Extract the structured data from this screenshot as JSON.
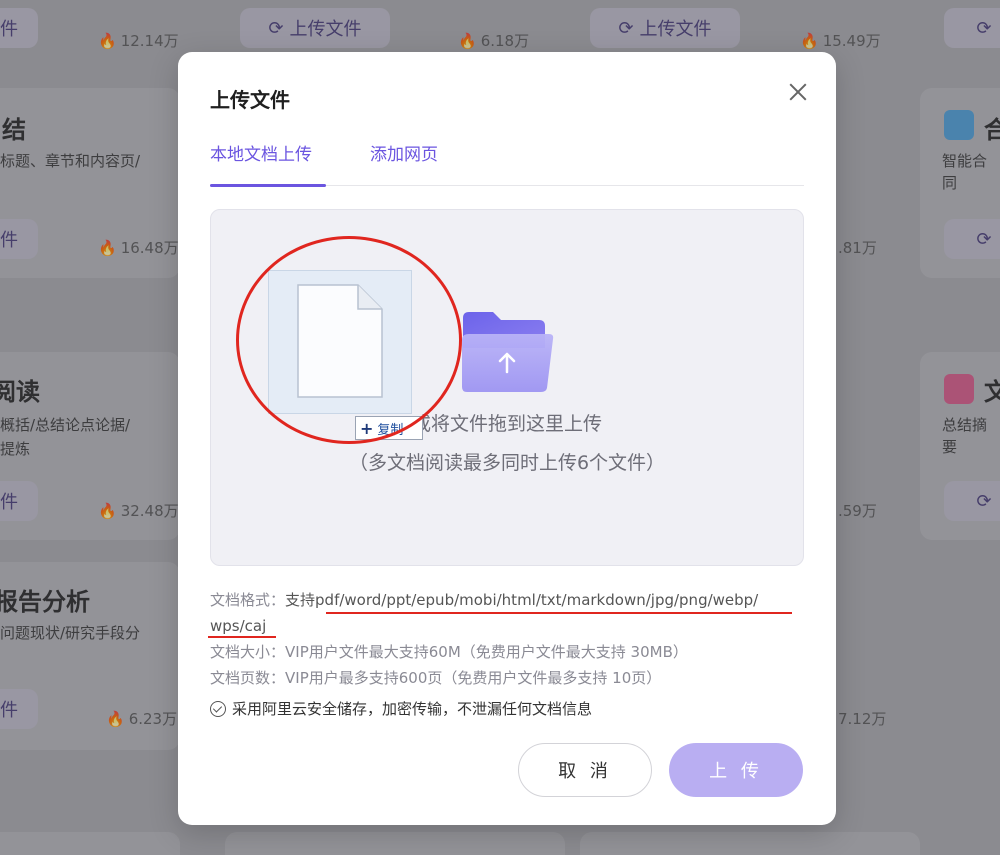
{
  "background": {
    "upload_label": "上传文件",
    "stats": [
      "12.14万",
      "6.18万",
      "15.49万",
      "16.48万",
      ".81万",
      "32.48万",
      ".59万",
      "6.23万",
      "7.12万"
    ],
    "titles": [
      "结",
      "合",
      "阅读",
      "文",
      "报告分析"
    ],
    "descs": [
      "标题、章节和内容页/",
      "智能合同",
      "概括/总结论点论据/",
      "提炼",
      "总结摘要",
      "问题现状/研究手段分"
    ],
    "partial_pill": "件"
  },
  "modal": {
    "title": "上传文件",
    "tabs": [
      {
        "label": "本地文档上传",
        "active": true
      },
      {
        "label": "添加网页",
        "active": false
      }
    ],
    "dropzone": {
      "main_text": "或将文件拖到这里上传",
      "sub_text": "（多文档阅读最多同时上传6个文件）"
    },
    "drag_ghost": {
      "badge": "复制"
    },
    "info": {
      "format_label": "文档格式：",
      "format_prefix": "支持",
      "format_list_1": "pdf/word/ppt/epub/mobi/html/txt/markdown/jpg/png/webp/",
      "format_list_2": "wps/caj",
      "size_label": "文档大小：",
      "size_text": "VIP用户文件最大支持60M（免费用户文件最大支持 30MB）",
      "pages_label": "文档页数：",
      "pages_text": "VIP用户最多支持600页（免费用户文件最多支持 10页）",
      "secure_text": "采用阿里云安全储存，加密传输，不泄漏任何文档信息"
    },
    "buttons": {
      "cancel": "取 消",
      "upload": "上 传"
    }
  },
  "colors": {
    "accent": "#6b55e0",
    "upload_btn": "#b9aef2",
    "annotation": "#e0261f"
  }
}
